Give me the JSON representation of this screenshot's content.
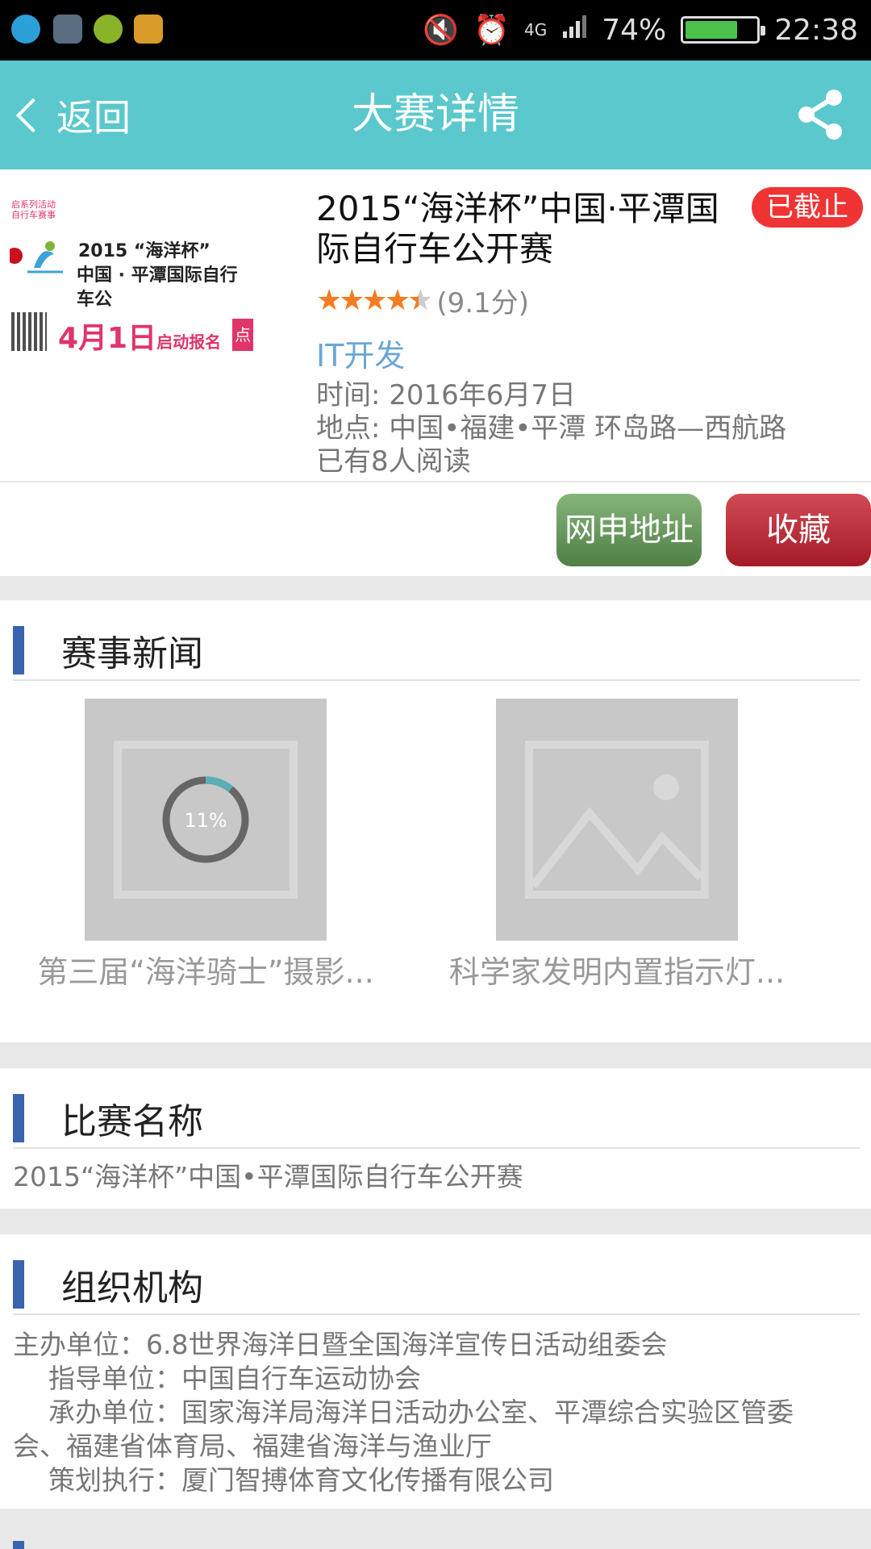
{
  "status_bar": {
    "battery": "74%",
    "time": "22:38",
    "network": "4G",
    "battery_level": 0.74
  },
  "header": {
    "back_label": "返回",
    "title": "大赛详情"
  },
  "event": {
    "title": "2015“海洋杯”中国·平潭国际自行车公开赛",
    "status_badge": "已截止",
    "rating_stars": 4.5,
    "rating_text": "(9.1分)",
    "category": "IT开发",
    "time": "时间: 2016年6月7日",
    "location": "地点: 中国•福建•平潭  环岛路—西航路",
    "reads": "已有8人阅读",
    "poster": {
      "small_text": "启系列活动\n自行车赛事",
      "title_line1": "2015 “海洋杯”",
      "title_line2": "中国 · 平潭国际自行车公",
      "date_main": "4月1日",
      "date_sub": "启动报名",
      "button": "点"
    }
  },
  "actions": {
    "apply_label": "网申地址",
    "favorite_label": "收藏"
  },
  "news": {
    "title": "赛事新闻",
    "items": [
      {
        "caption": "第三届“海洋骑士”摄影...",
        "progress_text": "11%",
        "progress": 0.11
      },
      {
        "caption": "科学家发明内置指示灯..."
      }
    ]
  },
  "competition": {
    "title": "比赛名称",
    "text": "2015“海洋杯”中国•平潭国际自行车公开赛"
  },
  "organization": {
    "title": "组织机构",
    "lines": [
      "主办单位：6.8世界海洋日暨全国海洋宣传日活动组委会",
      "指导单位：中国自行车运动协会",
      "承办单位：国家海洋局海洋日活动办公室、平潭综合实验区管委",
      "会、福建省体育局、福建省海洋与渔业厅",
      "策划执行：厦门智搏体育文化传播有限公司"
    ]
  },
  "colors": {
    "header": "#5ac8cc",
    "badge": "#f03434",
    "apply_button": "#5f8f55",
    "favorite_button": "#b52330",
    "section_bar": "#3a64ad",
    "category": "#6aa6d6"
  }
}
